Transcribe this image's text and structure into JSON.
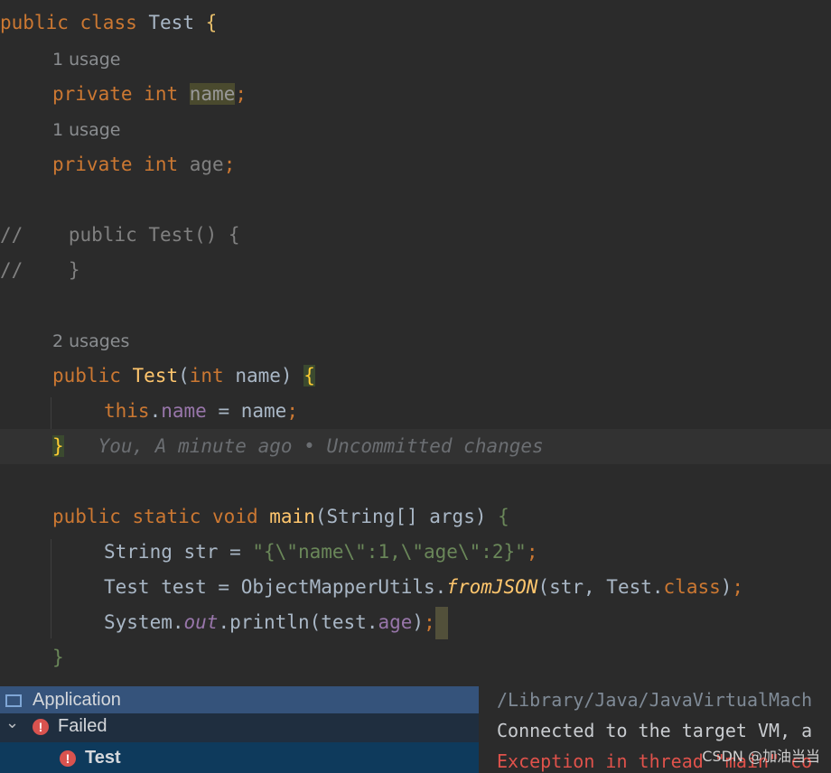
{
  "editor": {
    "class_decl": {
      "kw1": "public",
      "kw2": "class",
      "name": "Test",
      "brace": "{"
    },
    "usage_1": "1 usage",
    "field_name": {
      "kw1": "private",
      "kw2": "int",
      "name": "name",
      "semi": ";"
    },
    "usage_2": "1 usage",
    "field_age": {
      "kw1": "private",
      "kw2": "int",
      "name": "age",
      "semi": ";"
    },
    "commented_ctor_1": {
      "marker": "//",
      "code": "public Test() {"
    },
    "commented_ctor_2": {
      "marker": "//",
      "code": "}"
    },
    "usage_3": "2 usages",
    "ctor": {
      "kw1": "public",
      "name": "Test",
      "open": "(",
      "type": "int",
      "param": " name",
      "close": ")",
      "brace": "{"
    },
    "ctor_body": {
      "this": "this",
      "dot": ".",
      "field": "name",
      "rest": " = name",
      "semi": ";"
    },
    "ctor_close": {
      "brace": "}",
      "blame": "You, A minute ago • Uncommitted changes"
    },
    "main_decl": {
      "kw1": "public",
      "kw2": "static",
      "kw3": "void",
      "name": "main",
      "params": "(String[] args)",
      "brace": "{"
    },
    "main_line_1": {
      "decl": "String str = ",
      "str": "\"{\\\"name\\\":1,\\\"age\\\":2}\"",
      "semi": ";"
    },
    "main_line_2": {
      "decl": "Test test = ObjectMapperUtils.",
      "method": "fromJSON",
      "args": "(str, Test.",
      "cls": "class",
      "close": ")",
      "semi": ";"
    },
    "main_line_3": {
      "obj": "System.",
      "out": "out",
      "call": ".println(test.",
      "field": "age",
      "close": ")",
      "semi": ";"
    },
    "main_close": "}"
  },
  "run_panel": {
    "tree": {
      "root": "Application",
      "failed": "Failed",
      "test": "Test",
      "expand_glyph": "⌄",
      "error_glyph": "!"
    },
    "console": {
      "line_1": "/Library/Java/JavaVirtualMach",
      "line_2": "Connected to the target VM, a",
      "line_3": "Exception in thread \"main\" co"
    }
  },
  "watermark": "CSDN @加油当当",
  "colors": {
    "background": "#2b2b2b",
    "keyword": "#cc7832",
    "field": "#9876aa",
    "string": "#6a8759",
    "error": "#d9534f",
    "tree_bg": "#1f2e3f"
  }
}
